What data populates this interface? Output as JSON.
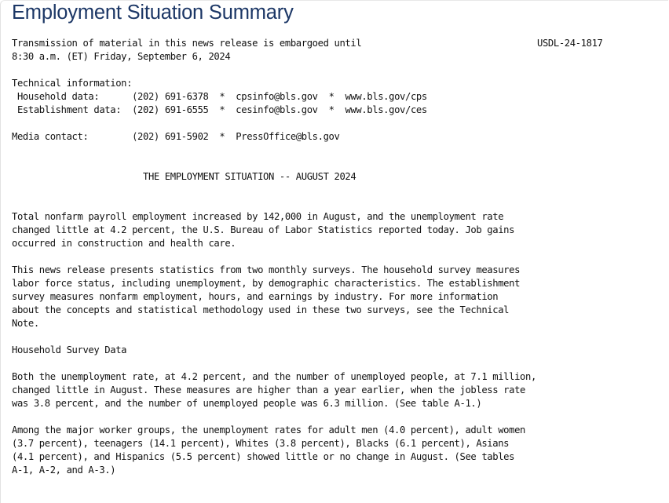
{
  "title": "Employment Situation Summary",
  "header": {
    "embargo_line1": "Transmission of material in this news release is embargoed until",
    "embargo_line2": "8:30 a.m. (ET) Friday, September 6, 2024",
    "release_id": "USDL-24-1817"
  },
  "contacts": {
    "technical_label": "Technical information:",
    "household": {
      "label": " Household data:      ",
      "phone": "(202) 691-6378",
      "email": "cpsinfo@bls.gov",
      "url": "www.bls.gov/cps"
    },
    "establishment": {
      "label": " Establishment data:  ",
      "phone": "(202) 691-6555",
      "email": "cesinfo@bls.gov",
      "url": "www.bls.gov/ces"
    },
    "media": {
      "label": "Media contact:        ",
      "phone": "(202) 691-5902",
      "email": "PressOffice@bls.gov"
    },
    "separator": "  *  "
  },
  "heading": "                        THE EMPLOYMENT SITUATION -- AUGUST 2024",
  "paragraphs": {
    "p1": [
      "Total nonfarm payroll employment increased by 142,000 in August, and the unemployment rate",
      "changed little at 4.2 percent, the U.S. Bureau of Labor Statistics reported today. Job gains",
      "occurred in construction and health care."
    ],
    "p2": [
      "This news release presents statistics from two monthly surveys. The household survey measures",
      "labor force status, including unemployment, by demographic characteristics. The establishment",
      "survey measures nonfarm employment, hours, and earnings by industry. For more information",
      "about the concepts and statistical methodology used in these two surveys, see the Technical",
      "Note."
    ],
    "section_heading": "Household Survey Data",
    "p3": [
      "Both the unemployment rate, at 4.2 percent, and the number of unemployed people, at 7.1 million,",
      "changed little in August. These measures are higher than a year earlier, when the jobless rate",
      "was 3.8 percent, and the number of unemployed people was 6.3 million. (See table A-1.)"
    ],
    "p4": [
      "Among the major worker groups, the unemployment rates for adult men (4.0 percent), adult women",
      "(3.7 percent), teenagers (14.1 percent), Whites (3.8 percent), Blacks (6.1 percent), Asians",
      "(4.1 percent), and Hispanics (5.5 percent) showed little or no change in August. (See tables",
      "A-1, A-2, and A-3.)"
    ]
  }
}
